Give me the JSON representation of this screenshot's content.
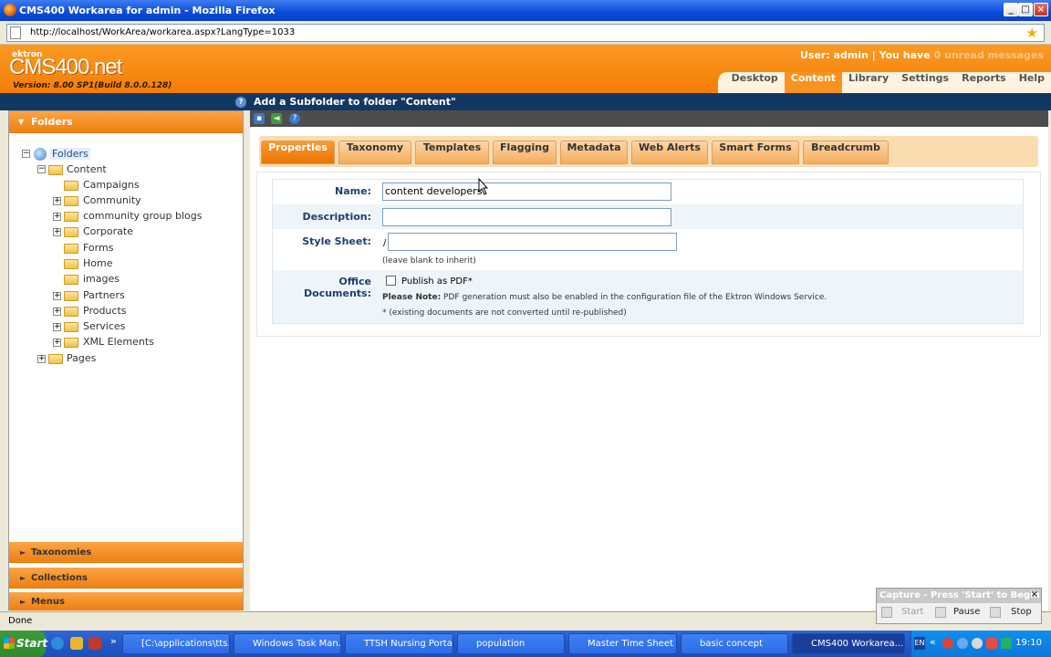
{
  "window": {
    "title": "CMS400 Workarea for admin - Mozilla Firefox",
    "buttons": [
      "_",
      "□",
      "×"
    ]
  },
  "browser": {
    "url": "http://localhost/WorkArea/workarea.aspx?LangType=1033"
  },
  "header": {
    "brand_small": "ektron",
    "brand": "CMS400.net",
    "version": "Version: 8.00 SP1(Build 8.0.0.128)",
    "user_text": "User: admin | You have ",
    "unread": "0 unread messages",
    "nav": [
      {
        "label": "Desktop",
        "active": false
      },
      {
        "label": "Content",
        "active": true
      },
      {
        "label": "Library",
        "active": false
      },
      {
        "label": "Settings",
        "active": false
      },
      {
        "label": "Reports",
        "active": false
      },
      {
        "label": "Help",
        "active": false
      }
    ]
  },
  "strip": {
    "title": "Add a Subfolder to folder \"Content\""
  },
  "sidebar": {
    "header": "Folders",
    "tree": {
      "root": "Folders",
      "content": "Content",
      "children": [
        "Campaigns",
        "Community",
        "community group blogs",
        "Corporate",
        "Forms",
        "Home",
        "images",
        "Partners",
        "Products",
        "Services",
        "XML Elements"
      ],
      "pages": "Pages"
    },
    "sections": [
      "Taxonomies",
      "Collections",
      "Menus"
    ]
  },
  "tabs": [
    "Properties",
    "Taxonomy",
    "Templates",
    "Flagging",
    "Metadata",
    "Web Alerts",
    "Smart Forms",
    "Breadcrumb"
  ],
  "form": {
    "name_label": "Name:",
    "name_value": "content developers",
    "desc_label": "Description:",
    "desc_value": "",
    "style_label": "Style Sheet:",
    "style_prefix": "/",
    "style_value": "",
    "style_hint": "(leave blank to inherit)",
    "office_label": "Office Documents:",
    "pdf_label": "Publish as PDF*",
    "note_bold": "Please Note:",
    "note_text": " PDF generation must also be enabled in the configuration file of the Ektron Windows Service.",
    "note2": "* (existing documents are not converted until re-published)"
  },
  "status": {
    "text": "Done"
  },
  "capture": {
    "title": "Capture - Press 'Start' to Begin",
    "start": "Start",
    "pause": "Pause",
    "stop": "Stop"
  },
  "taskbar": {
    "start": "Start",
    "items": [
      "[C:\\applications\\tts...",
      "Windows Task Man...",
      "TTSH Nursing Porta...",
      "population",
      "Master Time Sheet",
      "basic concept",
      "CMS400 Workarea..."
    ],
    "lang": "EN",
    "clock": "19:10"
  }
}
